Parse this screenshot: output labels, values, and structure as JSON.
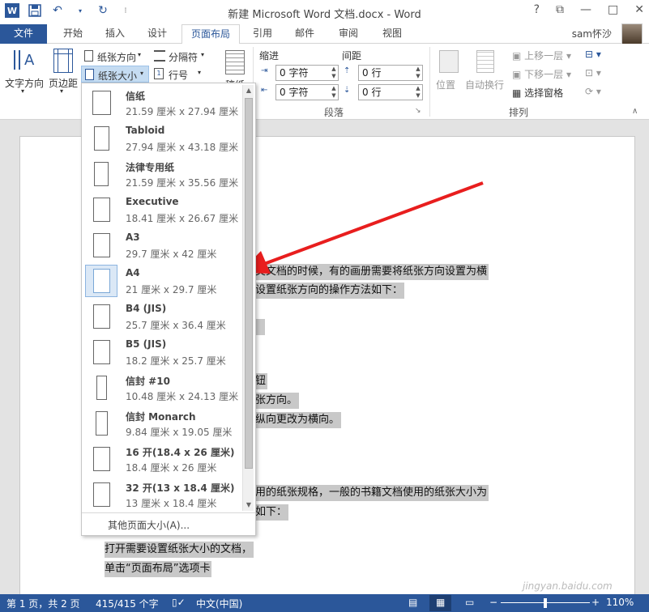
{
  "window": {
    "title": "新建 Microsoft Word 文档.docx - Word",
    "help": "?",
    "restore": "⧉",
    "minimize": "—",
    "maximize": "□",
    "close": "✕",
    "user": "sam怀沙"
  },
  "tabs": [
    "文件",
    "开始",
    "插入",
    "设计",
    "页面布局",
    "引用",
    "邮件",
    "审阅",
    "视图"
  ],
  "ribbon": {
    "text_direction": "文字方向",
    "margins": "页边距",
    "orientation": "纸张方向",
    "size": "纸张大小",
    "breaks": "分隔符",
    "line_numbers": "行号",
    "manuscript": "稿纸",
    "indent_label": "缩进",
    "spacing_label": "间距",
    "indent_left": "0 字符",
    "indent_right": "0 字符",
    "spacing_before": "0 行",
    "spacing_after": "0 行",
    "paragraph_group": "段落",
    "position": "位置",
    "wrap_text": "自动换行",
    "bring_forward": "上移一层",
    "send_backward": "下移一层",
    "selection_pane": "选择窗格",
    "arrange_group": "排列"
  },
  "paper_sizes": [
    {
      "name": "信纸",
      "size": "21.59 厘米 x 27.94 厘米"
    },
    {
      "name": "Tabloid",
      "size": "27.94 厘米 x 43.18 厘米"
    },
    {
      "name": "法律专用纸",
      "size": "21.59 厘米 x 35.56 厘米"
    },
    {
      "name": "Executive",
      "size": "18.41 厘米 x 26.67 厘米"
    },
    {
      "name": "A3",
      "size": "29.7 厘米 x 42 厘米"
    },
    {
      "name": "A4",
      "size": "21 厘米 x 29.7 厘米"
    },
    {
      "name": "B4 (JIS)",
      "size": "25.7 厘米 x 36.4 厘米"
    },
    {
      "name": "B5 (JIS)",
      "size": "18.2 厘米 x 25.7 厘米"
    },
    {
      "name": "信封 #10",
      "size": "10.48 厘米 x 24.13 厘米"
    },
    {
      "name": "信封 Monarch",
      "size": "9.84 厘米 x 19.05 厘米"
    },
    {
      "name": "16 开(18.4 x 26 厘米)",
      "size": "18.4 厘米 x 26 厘米"
    },
    {
      "name": "32 开(13 x 18.4 厘米)",
      "size": "13 厘米 x 18.4 厘米"
    }
  ],
  "selected_paper": "A4",
  "more_sizes": "其他页面大小(A)...",
  "document": {
    "l1": "类文档的时候，有的画册需要将纸张方向设置为横",
    "l2": "设置纸张方向的操作方法如下：",
    "l3": "",
    "l4": "钮",
    "l5": "张方向。",
    "l6": "纵向更改为横向。",
    "l7": "用的纸张规格，一般的书籍文档使用的纸张大小为",
    "l8": "如下：",
    "l9": "打开需要设置纸张大小的文档，",
    "l10": "单击“页面布局”选项卡"
  },
  "status": {
    "page": "第 1 页，共 2 页",
    "words": "415/415 个字",
    "lang": "中文(中国)",
    "zoom": "110%",
    "zoom_minus": "−",
    "zoom_plus": "+"
  },
  "watermark": "jingyan.baidu.com",
  "colors": {
    "accent": "#2b579a",
    "arrow": "#e81e1e"
  }
}
